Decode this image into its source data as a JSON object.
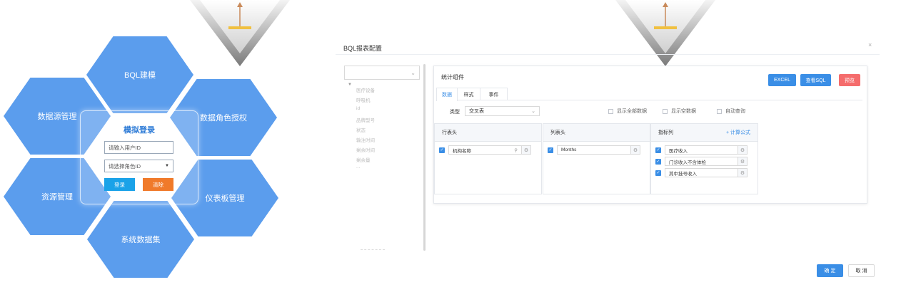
{
  "hexagons": {
    "bql": "BQL建模",
    "datasource": "数据源管理",
    "data_role": "数据角色授权",
    "resource": "资源管理",
    "dashboard": "仪表板管理",
    "dataset": "系统数据集"
  },
  "login": {
    "title": "模拟登录",
    "user_placeholder": "请输入用户ID",
    "role_placeholder": "请选择角色ID",
    "login_label": "登录",
    "clear_label": "清除"
  },
  "dialog": {
    "title": "BQL报表配置",
    "close": "×",
    "ok_label": "确 定",
    "cancel_label": "取 消"
  },
  "tree": {
    "items": [
      "医疗设备",
      "呼吸机",
      "id",
      "品牌型号",
      "状态",
      "输注时间",
      "剩余时间",
      "剩余量",
      "..."
    ]
  },
  "panel": {
    "title": "统计组件",
    "excel_label": "EXCEL",
    "sql_label": "查看SQL",
    "preview_label": "预览",
    "tabs": [
      "数据",
      "样式",
      "事件"
    ],
    "type_label": "类型",
    "type_value": "交叉表",
    "checkboxes": [
      "显示全部数据",
      "显示空数据",
      "自动查询"
    ],
    "row_header": {
      "title": "行表头",
      "fields": [
        "机构名称"
      ]
    },
    "col_header": {
      "title": "列表头",
      "fields": [
        "Months"
      ]
    },
    "metrics": {
      "title": "指标列",
      "add_formula": "+ 计算公式",
      "fields": [
        "医疗收入",
        "门诊收入不含体检",
        "其中挂号收入"
      ]
    }
  },
  "colors": {
    "hex_blue": "#5b9ded",
    "primary": "#3a8ee6",
    "danger": "#f56c6c",
    "login_blue": "#1aa2e8",
    "clear_orange": "#f07a2a"
  }
}
